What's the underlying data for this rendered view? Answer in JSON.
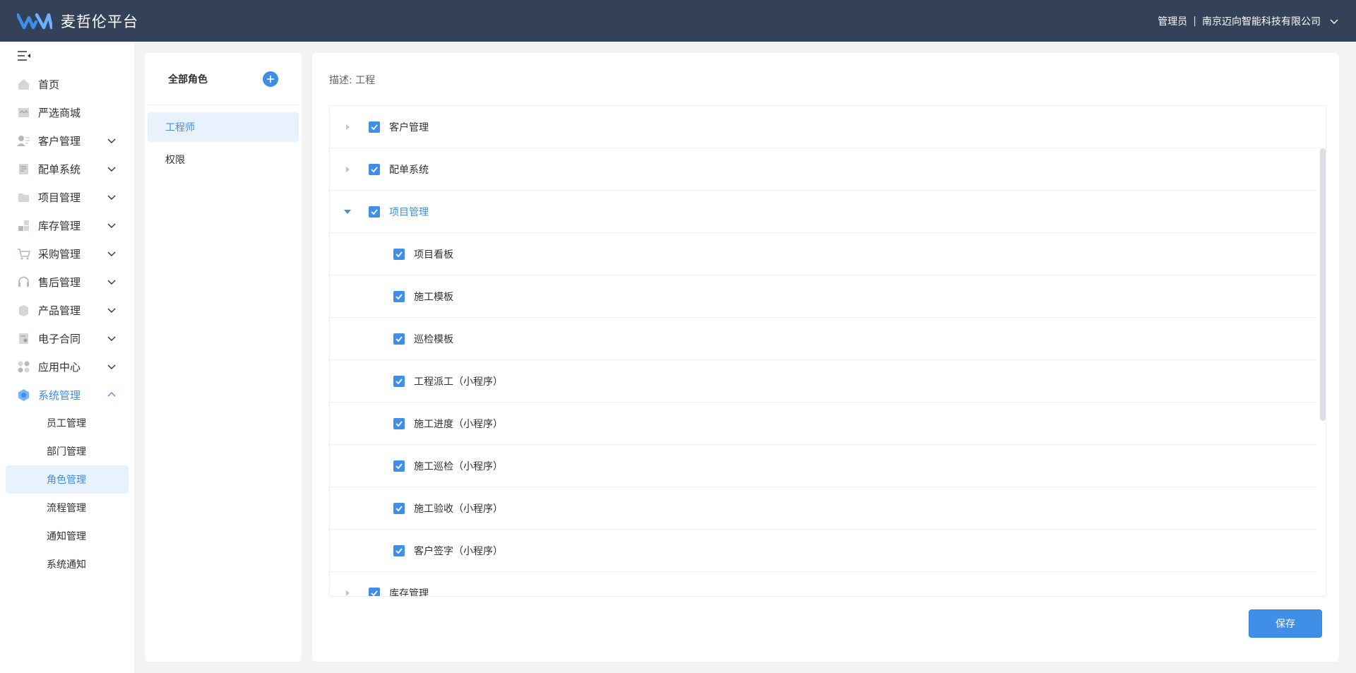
{
  "header": {
    "brand_title": "麦哲伦平台",
    "user_role": "管理员",
    "separator": "|",
    "company": "南京迈向智能科技有限公司"
  },
  "sidebar": {
    "items": [
      {
        "label": "首页",
        "icon": "home-icon",
        "expandable": false
      },
      {
        "label": "严选商城",
        "icon": "mall-icon",
        "expandable": false
      },
      {
        "label": "客户管理",
        "icon": "customer-icon",
        "expandable": true
      },
      {
        "label": "配单系统",
        "icon": "order-icon",
        "expandable": true
      },
      {
        "label": "项目管理",
        "icon": "folder-icon",
        "expandable": true
      },
      {
        "label": "库存管理",
        "icon": "inventory-icon",
        "expandable": true
      },
      {
        "label": "采购管理",
        "icon": "cart-icon",
        "expandable": true
      },
      {
        "label": "售后管理",
        "icon": "headset-icon",
        "expandable": true
      },
      {
        "label": "产品管理",
        "icon": "box-icon",
        "expandable": true
      },
      {
        "label": "电子合同",
        "icon": "contract-icon",
        "expandable": true
      },
      {
        "label": "应用中心",
        "icon": "apps-icon",
        "expandable": true
      },
      {
        "label": "系统管理",
        "icon": "system-icon",
        "expandable": true,
        "open": true
      }
    ],
    "sub_items": [
      {
        "label": "员工管理"
      },
      {
        "label": "部门管理"
      },
      {
        "label": "角色管理",
        "active": true
      },
      {
        "label": "流程管理"
      },
      {
        "label": "通知管理"
      },
      {
        "label": "系统通知"
      }
    ]
  },
  "roles": {
    "title": "全部角色",
    "items": [
      {
        "label": "工程师",
        "active": true
      },
      {
        "label": "权限",
        "active": false
      }
    ]
  },
  "main": {
    "description": "描述: 工程",
    "tree": [
      {
        "label": "客户管理",
        "level": 0,
        "checked": true,
        "caret": "right"
      },
      {
        "label": "配单系统",
        "level": 0,
        "checked": true,
        "caret": "right"
      },
      {
        "label": "项目管理",
        "level": 0,
        "checked": true,
        "caret": "down",
        "open": true
      },
      {
        "label": "项目看板",
        "level": 1,
        "checked": true
      },
      {
        "label": "施工模板",
        "level": 1,
        "checked": true
      },
      {
        "label": "巡检模板",
        "level": 1,
        "checked": true
      },
      {
        "label": "工程派工（小程序）",
        "level": 1,
        "checked": true
      },
      {
        "label": "施工进度（小程序）",
        "level": 1,
        "checked": true
      },
      {
        "label": "施工巡检（小程序）",
        "level": 1,
        "checked": true
      },
      {
        "label": "施工验收（小程序）",
        "level": 1,
        "checked": true
      },
      {
        "label": "客户签字（小程序）",
        "level": 1,
        "checked": true
      },
      {
        "label": "库存管理",
        "level": 0,
        "checked": true,
        "caret": "right"
      }
    ],
    "save_label": "保存"
  },
  "colors": {
    "header_bg": "#334159",
    "accent": "#3f8ee8",
    "active_bg": "#e8f2fd"
  }
}
